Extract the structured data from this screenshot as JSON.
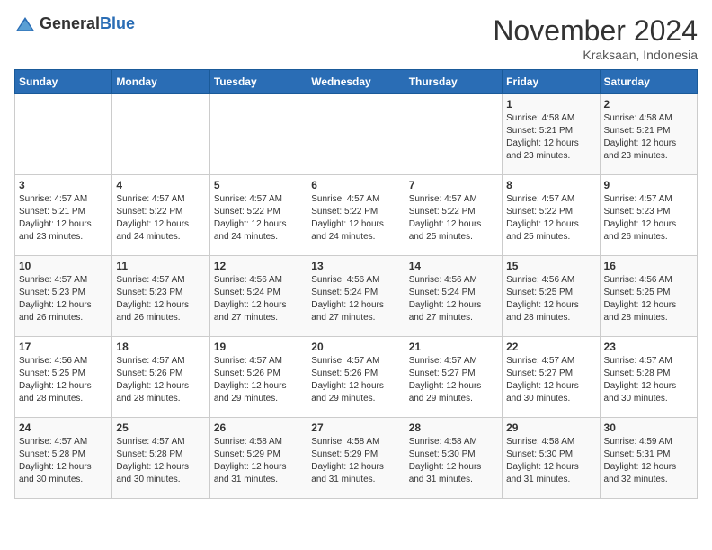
{
  "header": {
    "logo_general": "General",
    "logo_blue": "Blue",
    "month_title": "November 2024",
    "subtitle": "Kraksaan, Indonesia"
  },
  "days_of_week": [
    "Sunday",
    "Monday",
    "Tuesday",
    "Wednesday",
    "Thursday",
    "Friday",
    "Saturday"
  ],
  "weeks": [
    [
      {
        "day": "",
        "info": ""
      },
      {
        "day": "",
        "info": ""
      },
      {
        "day": "",
        "info": ""
      },
      {
        "day": "",
        "info": ""
      },
      {
        "day": "",
        "info": ""
      },
      {
        "day": "1",
        "info": "Sunrise: 4:58 AM\nSunset: 5:21 PM\nDaylight: 12 hours and 23 minutes."
      },
      {
        "day": "2",
        "info": "Sunrise: 4:58 AM\nSunset: 5:21 PM\nDaylight: 12 hours and 23 minutes."
      }
    ],
    [
      {
        "day": "3",
        "info": "Sunrise: 4:57 AM\nSunset: 5:21 PM\nDaylight: 12 hours and 23 minutes."
      },
      {
        "day": "4",
        "info": "Sunrise: 4:57 AM\nSunset: 5:22 PM\nDaylight: 12 hours and 24 minutes."
      },
      {
        "day": "5",
        "info": "Sunrise: 4:57 AM\nSunset: 5:22 PM\nDaylight: 12 hours and 24 minutes."
      },
      {
        "day": "6",
        "info": "Sunrise: 4:57 AM\nSunset: 5:22 PM\nDaylight: 12 hours and 24 minutes."
      },
      {
        "day": "7",
        "info": "Sunrise: 4:57 AM\nSunset: 5:22 PM\nDaylight: 12 hours and 25 minutes."
      },
      {
        "day": "8",
        "info": "Sunrise: 4:57 AM\nSunset: 5:22 PM\nDaylight: 12 hours and 25 minutes."
      },
      {
        "day": "9",
        "info": "Sunrise: 4:57 AM\nSunset: 5:23 PM\nDaylight: 12 hours and 26 minutes."
      }
    ],
    [
      {
        "day": "10",
        "info": "Sunrise: 4:57 AM\nSunset: 5:23 PM\nDaylight: 12 hours and 26 minutes."
      },
      {
        "day": "11",
        "info": "Sunrise: 4:57 AM\nSunset: 5:23 PM\nDaylight: 12 hours and 26 minutes."
      },
      {
        "day": "12",
        "info": "Sunrise: 4:56 AM\nSunset: 5:24 PM\nDaylight: 12 hours and 27 minutes."
      },
      {
        "day": "13",
        "info": "Sunrise: 4:56 AM\nSunset: 5:24 PM\nDaylight: 12 hours and 27 minutes."
      },
      {
        "day": "14",
        "info": "Sunrise: 4:56 AM\nSunset: 5:24 PM\nDaylight: 12 hours and 27 minutes."
      },
      {
        "day": "15",
        "info": "Sunrise: 4:56 AM\nSunset: 5:25 PM\nDaylight: 12 hours and 28 minutes."
      },
      {
        "day": "16",
        "info": "Sunrise: 4:56 AM\nSunset: 5:25 PM\nDaylight: 12 hours and 28 minutes."
      }
    ],
    [
      {
        "day": "17",
        "info": "Sunrise: 4:56 AM\nSunset: 5:25 PM\nDaylight: 12 hours and 28 minutes."
      },
      {
        "day": "18",
        "info": "Sunrise: 4:57 AM\nSunset: 5:26 PM\nDaylight: 12 hours and 28 minutes."
      },
      {
        "day": "19",
        "info": "Sunrise: 4:57 AM\nSunset: 5:26 PM\nDaylight: 12 hours and 29 minutes."
      },
      {
        "day": "20",
        "info": "Sunrise: 4:57 AM\nSunset: 5:26 PM\nDaylight: 12 hours and 29 minutes."
      },
      {
        "day": "21",
        "info": "Sunrise: 4:57 AM\nSunset: 5:27 PM\nDaylight: 12 hours and 29 minutes."
      },
      {
        "day": "22",
        "info": "Sunrise: 4:57 AM\nSunset: 5:27 PM\nDaylight: 12 hours and 30 minutes."
      },
      {
        "day": "23",
        "info": "Sunrise: 4:57 AM\nSunset: 5:28 PM\nDaylight: 12 hours and 30 minutes."
      }
    ],
    [
      {
        "day": "24",
        "info": "Sunrise: 4:57 AM\nSunset: 5:28 PM\nDaylight: 12 hours and 30 minutes."
      },
      {
        "day": "25",
        "info": "Sunrise: 4:57 AM\nSunset: 5:28 PM\nDaylight: 12 hours and 30 minutes."
      },
      {
        "day": "26",
        "info": "Sunrise: 4:58 AM\nSunset: 5:29 PM\nDaylight: 12 hours and 31 minutes."
      },
      {
        "day": "27",
        "info": "Sunrise: 4:58 AM\nSunset: 5:29 PM\nDaylight: 12 hours and 31 minutes."
      },
      {
        "day": "28",
        "info": "Sunrise: 4:58 AM\nSunset: 5:30 PM\nDaylight: 12 hours and 31 minutes."
      },
      {
        "day": "29",
        "info": "Sunrise: 4:58 AM\nSunset: 5:30 PM\nDaylight: 12 hours and 31 minutes."
      },
      {
        "day": "30",
        "info": "Sunrise: 4:59 AM\nSunset: 5:31 PM\nDaylight: 12 hours and 32 minutes."
      }
    ]
  ]
}
